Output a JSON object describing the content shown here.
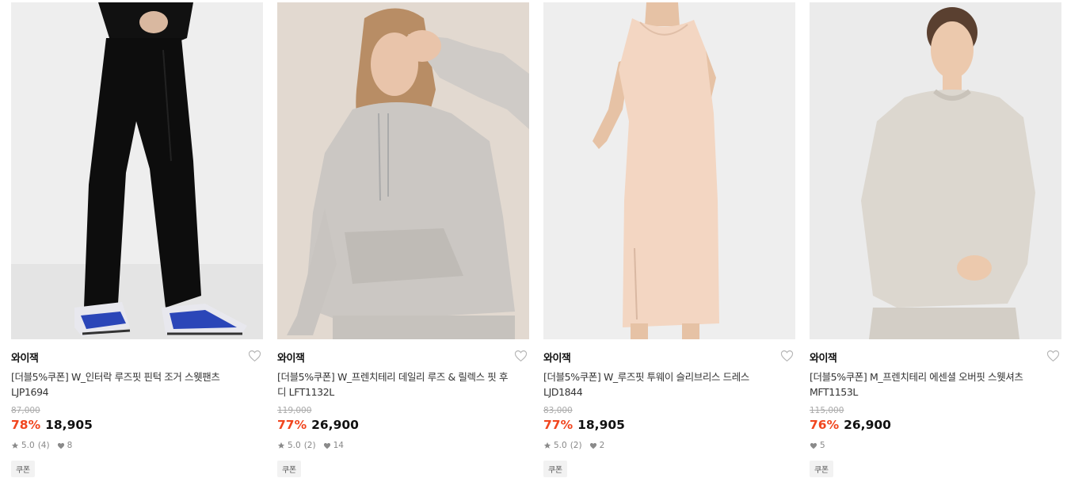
{
  "products": [
    {
      "brand": "와이잭",
      "title": "[더블5%쿠폰] W_인터락 루즈핏 핀턱 조거 스웻팬츠 LJP1694",
      "original_price": "87,000",
      "discount": "78%",
      "price": "18,905",
      "rating": "5.0",
      "review_count": "(4)",
      "likes": "8",
      "tag": "쿠폰",
      "image_icon": "product-photo-black-jogger-pants",
      "bg_color": "#efefef"
    },
    {
      "brand": "와이잭",
      "title": "[더블5%쿠폰] W_프렌치테리 데일리 루즈 & 릴렉스 핏 후디 LFT1132L",
      "original_price": "119,000",
      "discount": "77%",
      "price": "26,900",
      "rating": "5.0",
      "review_count": "(2)",
      "likes": "14",
      "tag": "쿠폰",
      "image_icon": "product-photo-grey-hoodie",
      "bg_color": "#e3dbd3"
    },
    {
      "brand": "와이잭",
      "title": "[더블5%쿠폰] W_루즈핏 투웨이 슬리브리스 드레스 LJD1844",
      "original_price": "83,000",
      "discount": "77%",
      "price": "18,905",
      "rating": "5.0",
      "review_count": "(2)",
      "likes": "2",
      "tag": "쿠폰",
      "image_icon": "product-photo-beige-sleeveless-dress",
      "bg_color": "#eeeeee"
    },
    {
      "brand": "와이잭",
      "title": "[더블5%쿠폰] M_프렌치테리 에센셜 오버핏 스웻셔츠 MFT1153L",
      "original_price": "115,000",
      "discount": "76%",
      "price": "26,900",
      "rating": "",
      "review_count": "",
      "likes": "5",
      "tag": "쿠폰",
      "image_icon": "product-photo-oatmeal-sweatshirt",
      "bg_color": "#ebebeb"
    }
  ],
  "colors": {
    "discount": "#f1461f",
    "original_price": "#aaaaaa",
    "meta": "#888888"
  }
}
